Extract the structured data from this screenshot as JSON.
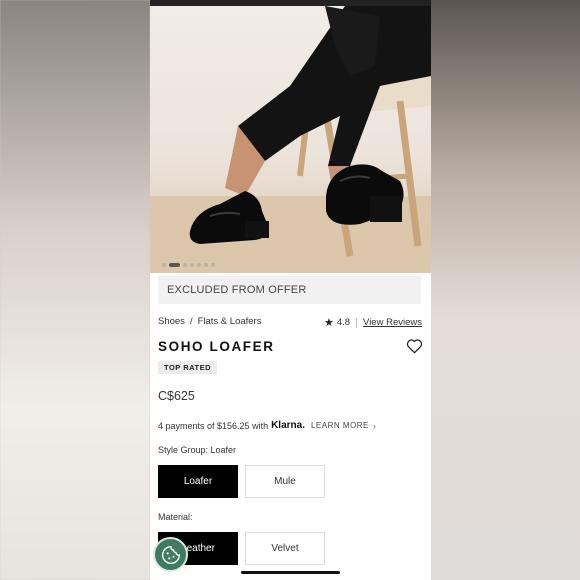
{
  "offer_banner": "EXCLUDED FROM OFFER",
  "breadcrumb": [
    "Shoes",
    "Flats & Loafers"
  ],
  "breadcrumb_separator": "/",
  "rating": {
    "value": "4.8",
    "reviews_link": "View Reviews"
  },
  "product": {
    "title": "SOHO LOAFER",
    "badge": "TOP RATED",
    "price": "C$625"
  },
  "klarna": {
    "text": "4 payments of $156.25 with",
    "brand": "Klarna.",
    "learn_more": "LEARN MORE"
  },
  "style_group": {
    "label": "Style Group: Loafer",
    "options": [
      "Loafer",
      "Mule"
    ],
    "selected": "Loafer"
  },
  "material": {
    "label": "Material:",
    "options": [
      "Leather",
      "Velvet"
    ],
    "selected": "Leather"
  },
  "carousel": {
    "total": 7,
    "active": 1
  },
  "icons": {
    "star": "star-icon",
    "heart": "heart-icon",
    "chevron": "chevron-right-icon",
    "cookie": "cookie-icon"
  },
  "colors": {
    "selected_option": "#000000",
    "cookie_button": "#3f7a63"
  }
}
